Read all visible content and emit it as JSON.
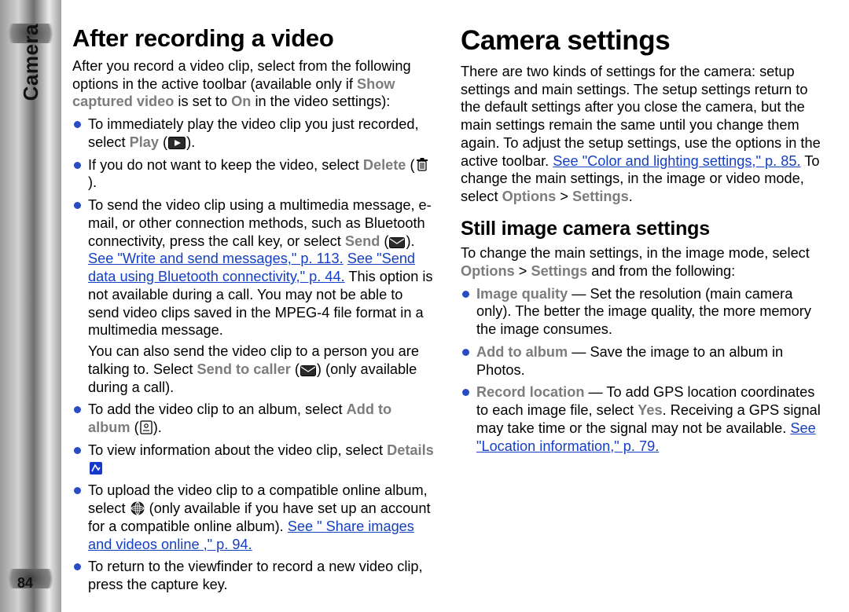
{
  "meta": {
    "section_label": "Camera",
    "page_number": "84"
  },
  "after_recording": {
    "title": "After recording a video",
    "intro_pre": "After you record a video clip, select from the following options in the active toolbar (available only if ",
    "intro_bold1": "Show captured video",
    "intro_mid": " is set to ",
    "intro_bold2": "On",
    "intro_post": " in the video settings):",
    "b1_pre": "To immediately play the video clip you just recorded, select ",
    "b1_cmd": "Play",
    "b1_post": " (",
    "b1_close": ").",
    "b2_pre": "If you do not want to keep the video, select ",
    "b2_cmd": "Delete",
    "b2_post": " (",
    "b2_close": ").",
    "b3_pre": "To send the video clip using a multimedia message, e-mail, or other connection methods, such as Bluetooth connectivity, press the call key, or select ",
    "b3_cmd": "Send",
    "b3_post1": " (",
    "b3_post2": "). ",
    "b3_link1": "See \"Write and send messages,\" p. 113.",
    "b3_gap": " ",
    "b3_link2": "See \"Send data using Bluetooth connectivity,\" p. 44.",
    "b3_tail": " This option is not available during a call. You may not be able to send video clips saved in the MPEG-4 file format in a multimedia message.",
    "b3_p2_pre": "You can also send the video clip to a person you are talking to. Select ",
    "b3_p2_cmd": "Send to caller",
    "b3_p2_mid": " (",
    "b3_p2_post": ") (only available during a call).",
    "b4_pre": "To add the video clip to an album, select ",
    "b4_cmd": "Add to album",
    "b4_post": " (",
    "b4_close": ").",
    "b5_pre": "To view information about the video clip, select ",
    "b5_cmd": "Details",
    "b5_post": " ",
    "b6_pre": "To upload the video clip to a compatible online album, select ",
    "b6_mid": " (only available if you have set up an account for a compatible online album). ",
    "b6_link": "See \" Share images and videos online ,\" p. 94.",
    "b7_text": "To return to the viewfinder to record a new video clip, press the capture key."
  },
  "camera_settings": {
    "title": "Camera settings",
    "p1_pre": "There are two kinds of settings for the camera: setup settings and main settings. The setup settings return to the default settings after you close the camera, but the main settings remain the same until you change them again. To adjust the setup settings, use the options in the active toolbar. ",
    "p1_link": "See \"Color and lighting settings,\" p. 85.",
    "p1_mid": " To change the main settings, in the image or video mode, select ",
    "p1_opt": "Options",
    "p1_gt": " > ",
    "p1_set": "Settings",
    "p1_end": "."
  },
  "still_image": {
    "title": "Still image camera settings",
    "intro_pre": "To change the main settings, in the image mode, select ",
    "intro_opt": "Options",
    "intro_gt": " > ",
    "intro_set": "Settings",
    "intro_post": " and from the following:",
    "i1_lbl": "Image quality",
    "i1_txt": " — Set the resolution (main camera only). The better the image quality, the more memory the image consumes.",
    "i2_lbl": "Add to album",
    "i2_txt": " — Save the image to an album in Photos.",
    "i3_lbl": "Record location",
    "i3_pre": " — To add GPS location coordinates to each image file, select ",
    "i3_yes": "Yes",
    "i3_post": ". Receiving a GPS signal may take time or the signal may not be available. ",
    "i3_link": "See \"Location information,\" p. 79."
  }
}
